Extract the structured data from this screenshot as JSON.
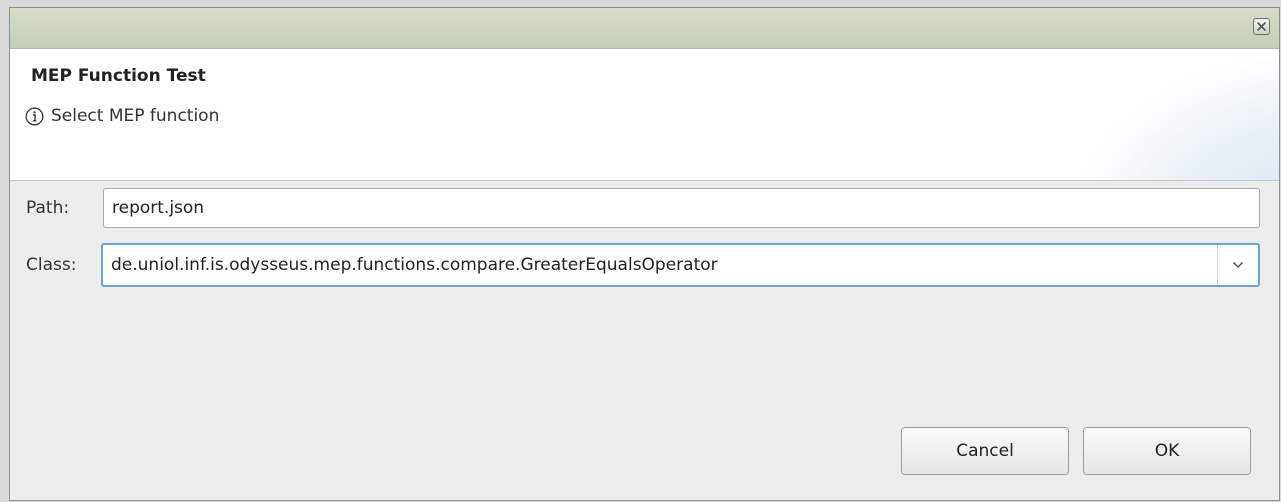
{
  "dialog": {
    "title": "MEP Function Test",
    "message": "Select MEP function"
  },
  "icons": {
    "close": "close-icon",
    "info": "info-icon",
    "dropdown": "chevron-down-icon"
  },
  "form": {
    "path_label": "Path:",
    "path_value": "report.json",
    "class_label": "Class:",
    "class_value": "de.uniol.inf.is.odysseus.mep.functions.compare.GreaterEqualsOperator"
  },
  "buttons": {
    "cancel": "Cancel",
    "ok": "OK"
  },
  "colors": {
    "titlebar": "#c9d1bd",
    "focus_border": "#6fa3d6",
    "dialog_bg": "#ededed"
  }
}
